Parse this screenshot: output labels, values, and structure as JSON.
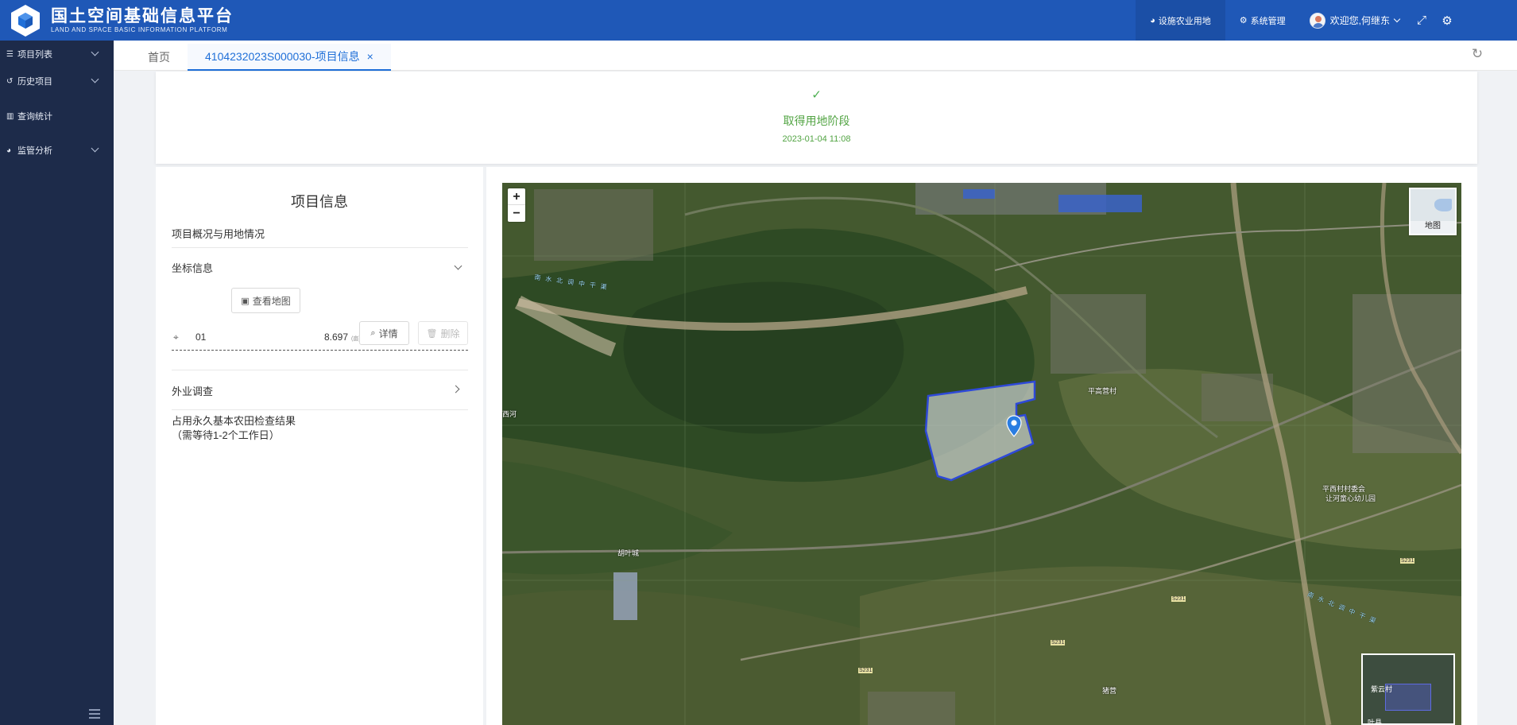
{
  "header": {
    "title": "国土空间基础信息平台",
    "subtitle": "LAND AND SPACE BASIC INFORMATION PLATFORM",
    "nav": [
      {
        "label": "设施农业用地",
        "icon": "pie-chart-icon",
        "active": true
      },
      {
        "label": "系统管理",
        "icon": "cogs-icon",
        "active": false
      }
    ],
    "user_greeting": "欢迎您,何继东",
    "colors": {
      "header_bg": "#1f58b7",
      "sidebar_bg": "#1d2b4a",
      "accent": "#1f6fd8",
      "success": "#52a443"
    }
  },
  "sidebar": {
    "items": [
      {
        "label": "项目列表",
        "icon": "list-icon"
      },
      {
        "label": "历史项目",
        "icon": "history-icon"
      },
      {
        "label": "查询统计",
        "icon": "bar-chart-icon"
      },
      {
        "label": "监管分析",
        "icon": "pie-chart-icon"
      }
    ]
  },
  "tabs": {
    "home": "首页",
    "active": "4104232023S000030-项目信息",
    "close": "×"
  },
  "status": {
    "stage": "取得用地阶段",
    "time": "2023-01-04 11:08"
  },
  "project": {
    "title": "项目信息",
    "overview": "项目概况与用地情况",
    "coord_section": "坐标信息",
    "view_map_button": "查看地图",
    "coord_id": "01",
    "coord_area": "8.697",
    "coord_unit": "(亩)",
    "detail_button": "详情",
    "delete_button": "删除",
    "field_survey": "外业调查",
    "farmland_check_line1": "占用永久基本农田检查结果",
    "farmland_check_line2": "（需等待1-2个工作日）"
  },
  "map": {
    "zoom_in": "+",
    "zoom_out": "−",
    "switch_label": "地图",
    "labels": {
      "village1": "平高营村",
      "village2": "胡叶城",
      "kindergarten": "平西村村委会",
      "kindergarten2": "让河童心幼儿园",
      "place1": "西河",
      "place2": "猪营",
      "road1": "S231",
      "road2": "S231",
      "road3": "S231",
      "road4": "S231"
    },
    "river_labels": [
      "南水北调中干渠",
      "南水北调中干渠"
    ],
    "overview_label1": "紫云村",
    "overview_label2": "叶县"
  }
}
